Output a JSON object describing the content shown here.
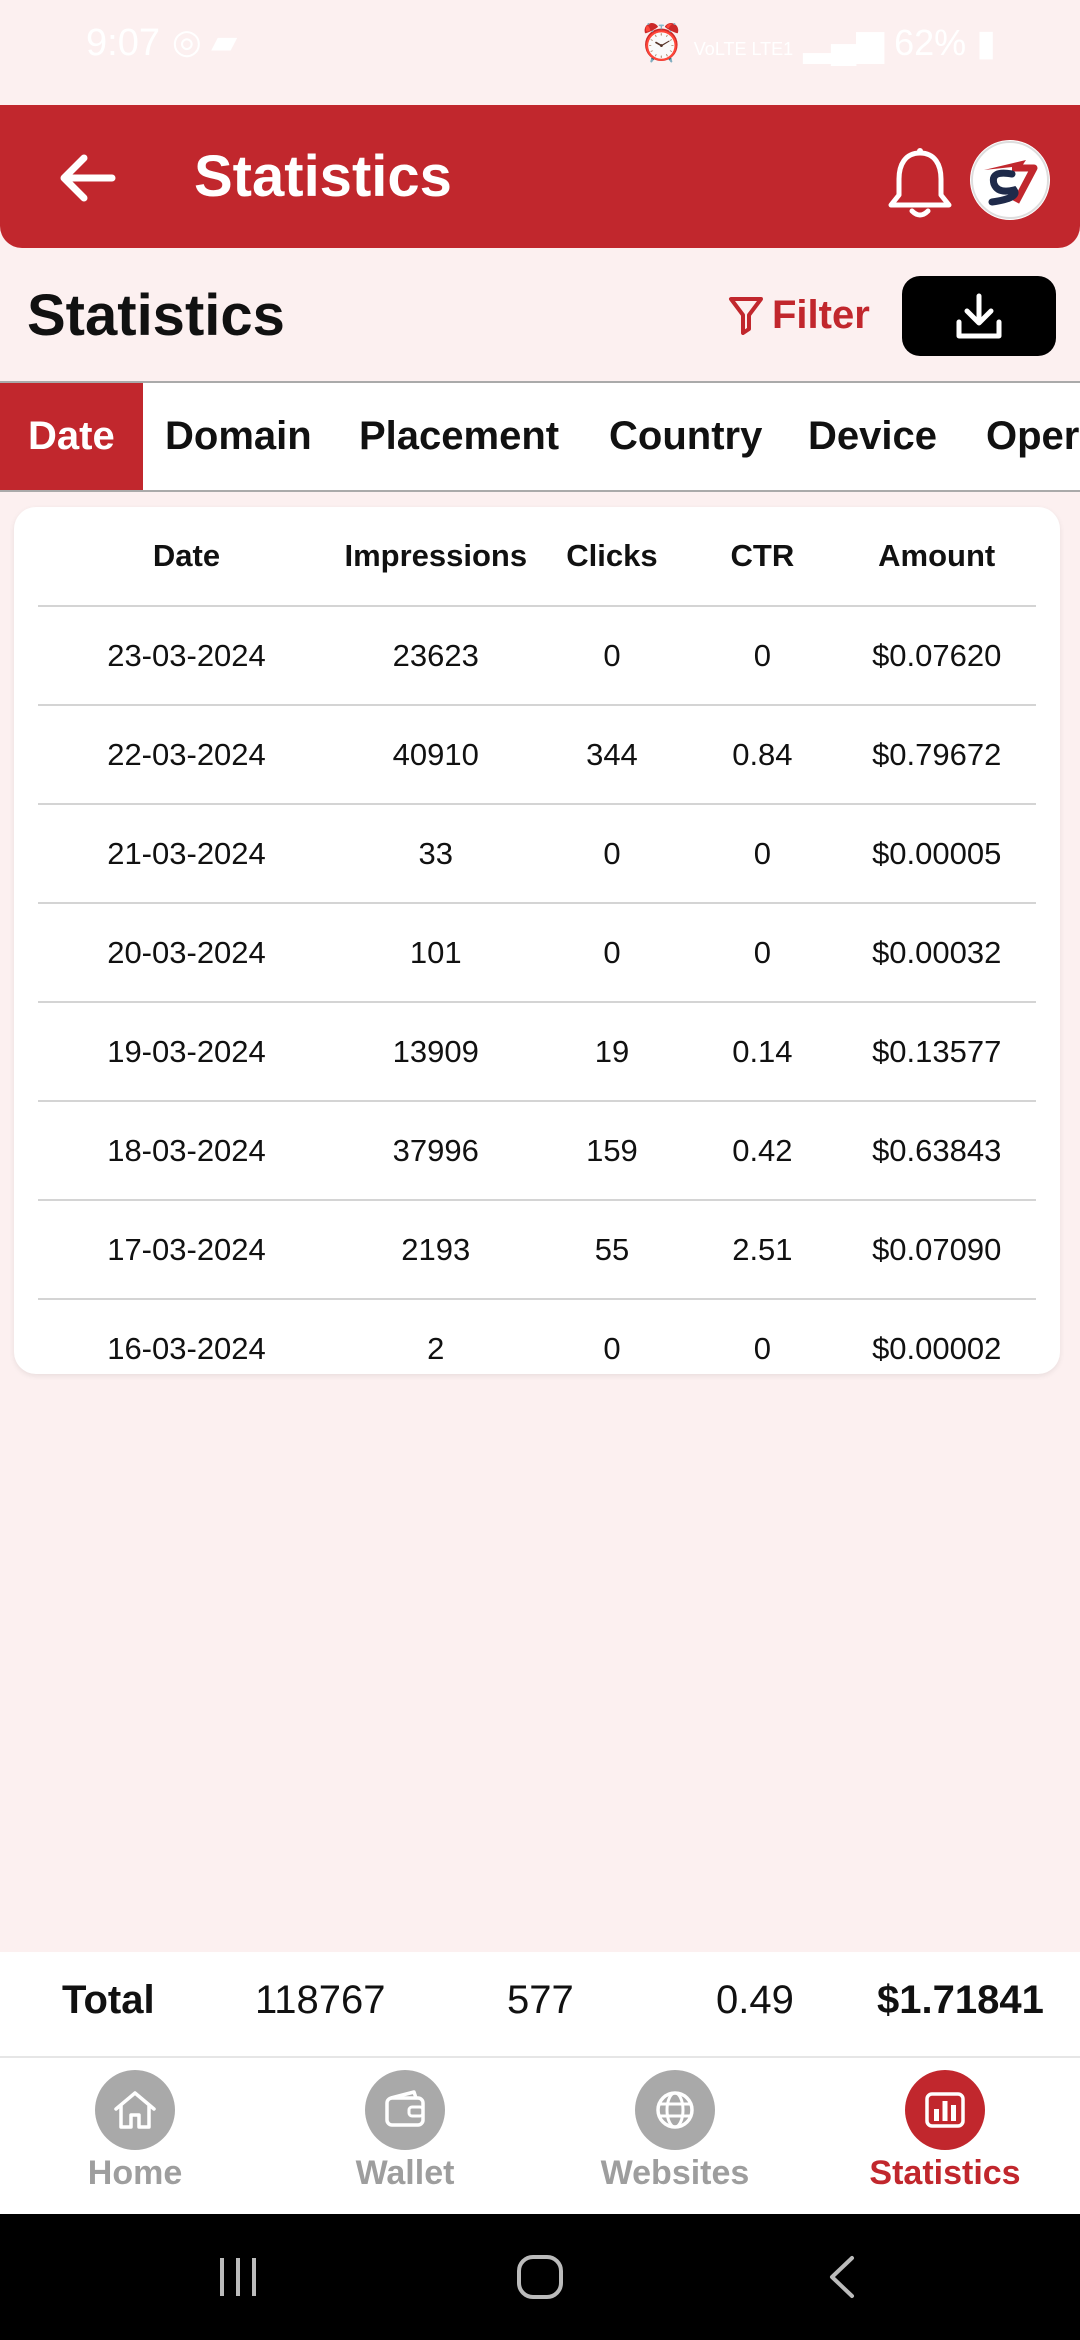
{
  "status_bar": {
    "time": "9:07",
    "battery": "62%",
    "network": "VoLTE LTE1"
  },
  "app_bar": {
    "title": "Statistics",
    "back_icon": "arrow-left-icon",
    "bell_icon": "bell-icon",
    "avatar": "s7-logo"
  },
  "header": {
    "title": "Statistics",
    "filter_label": "Filter",
    "download_icon": "download-icon"
  },
  "tabs": [
    {
      "label": "Date",
      "active": true
    },
    {
      "label": "Domain",
      "active": false
    },
    {
      "label": "Placement",
      "active": false
    },
    {
      "label": "Country",
      "active": false
    },
    {
      "label": "Device",
      "active": false
    },
    {
      "label": "Opera",
      "active": false
    }
  ],
  "table": {
    "columns": [
      "Date",
      "Impressions",
      "Clicks",
      "CTR",
      "Amount"
    ],
    "rows": [
      {
        "date": "23-03-2024",
        "impressions": "23623",
        "clicks": "0",
        "ctr": "0",
        "amount": "$0.07620"
      },
      {
        "date": "22-03-2024",
        "impressions": "40910",
        "clicks": "344",
        "ctr": "0.84",
        "amount": "$0.79672"
      },
      {
        "date": "21-03-2024",
        "impressions": "33",
        "clicks": "0",
        "ctr": "0",
        "amount": "$0.00005"
      },
      {
        "date": "20-03-2024",
        "impressions": "101",
        "clicks": "0",
        "ctr": "0",
        "amount": "$0.00032"
      },
      {
        "date": "19-03-2024",
        "impressions": "13909",
        "clicks": "19",
        "ctr": "0.14",
        "amount": "$0.13577"
      },
      {
        "date": "18-03-2024",
        "impressions": "37996",
        "clicks": "159",
        "ctr": "0.42",
        "amount": "$0.63843"
      },
      {
        "date": "17-03-2024",
        "impressions": "2193",
        "clicks": "55",
        "ctr": "2.51",
        "amount": "$0.07090"
      },
      {
        "date": "16-03-2024",
        "impressions": "2",
        "clicks": "0",
        "ctr": "0",
        "amount": "$0.00002"
      }
    ]
  },
  "total": {
    "label": "Total",
    "impressions": "118767",
    "clicks": "577",
    "ctr": "0.49",
    "amount": "$1.71841"
  },
  "bottom_nav": [
    {
      "label": "Home",
      "icon": "home-icon",
      "active": false
    },
    {
      "label": "Wallet",
      "icon": "wallet-icon",
      "active": false
    },
    {
      "label": "Websites",
      "icon": "globe-icon",
      "active": false
    },
    {
      "label": "Statistics",
      "icon": "bar-chart-icon",
      "active": true
    }
  ],
  "colors": {
    "accent": "#c1272d",
    "background": "#fcf0f0"
  }
}
